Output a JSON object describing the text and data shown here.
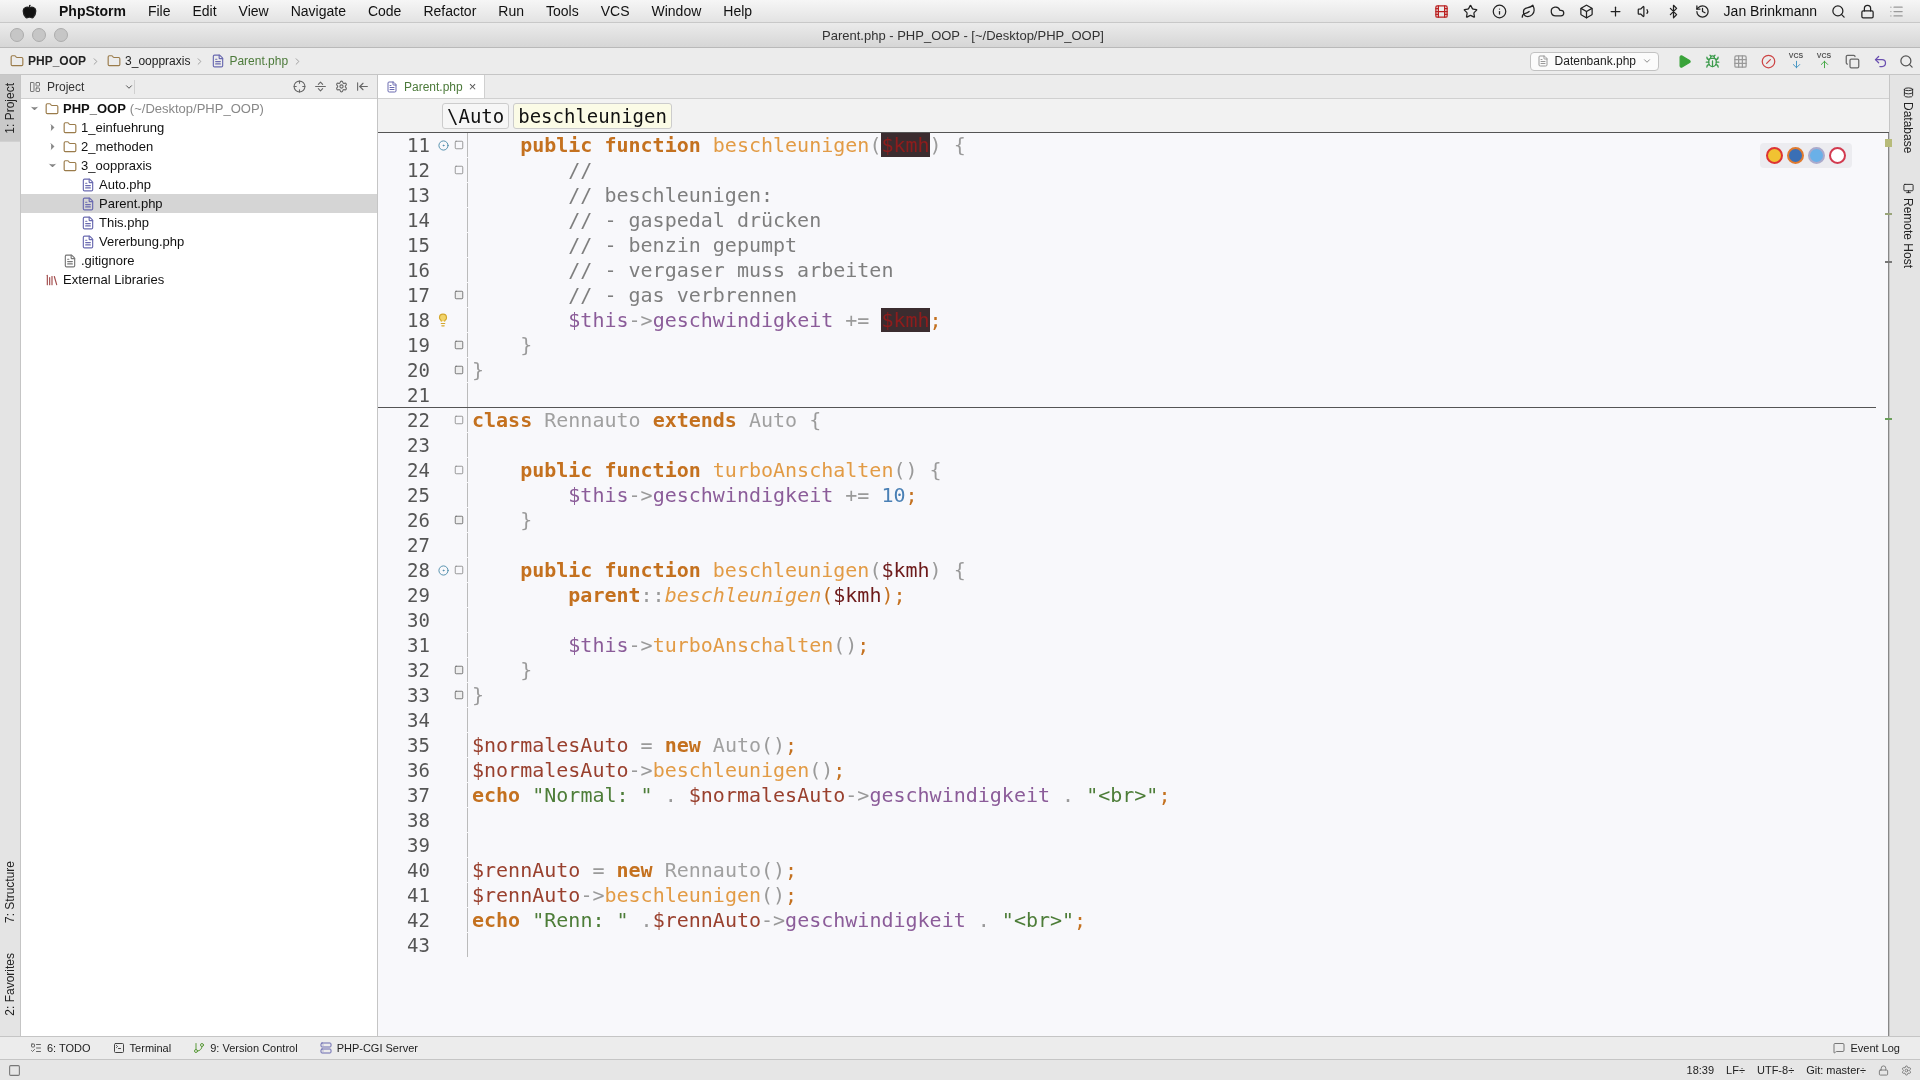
{
  "menu_bar": {
    "app": "PhpStorm",
    "items": [
      "File",
      "Edit",
      "View",
      "Navigate",
      "Code",
      "Refactor",
      "Run",
      "Tools",
      "VCS",
      "Window",
      "Help"
    ],
    "user": "Jan Brinkmann"
  },
  "window": {
    "title": "Parent.php - PHP_OOP - [~/Desktop/PHP_OOP]"
  },
  "breadcrumbs": [
    {
      "label": "PHP_OOP",
      "kind": "folder"
    },
    {
      "label": "3_ooppraxis",
      "kind": "folder"
    },
    {
      "label": "Parent.php",
      "kind": "php"
    }
  ],
  "run_config": "Datenbank.php",
  "toolbar": [
    {
      "kind": "run"
    },
    {
      "kind": "debug"
    },
    {
      "kind": "coverage"
    },
    {
      "kind": "stop"
    },
    {
      "kind": "vcs_update",
      "label": "VCS"
    },
    {
      "kind": "vcs_commit",
      "label": "VCS"
    },
    {
      "kind": "history"
    },
    {
      "kind": "revert"
    }
  ],
  "left_stripe": {
    "top": [
      {
        "label": "1: Project",
        "selected": true
      }
    ],
    "bottom": [
      {
        "label": "7: Structure",
        "selected": false
      },
      {
        "label": "2: Favorites",
        "selected": false
      }
    ]
  },
  "right_stripe": [
    {
      "label": "Database"
    },
    {
      "label": "Remote Host"
    }
  ],
  "project": {
    "title": "Project",
    "tree": [
      {
        "label": "PHP_OOP",
        "detail": "(~/Desktop/PHP_OOP)",
        "kind": "folder",
        "expanded": true,
        "selected": false,
        "children": [
          {
            "label": "1_einfuehrung",
            "kind": "folder",
            "expanded": false,
            "selected": false
          },
          {
            "label": "2_methoden",
            "kind": "folder",
            "expanded": false,
            "selected": false
          },
          {
            "label": "3_ooppraxis",
            "kind": "folder",
            "expanded": true,
            "selected": false,
            "children": [
              {
                "label": "Auto.php",
                "kind": "php",
                "selected": false
              },
              {
                "label": "Parent.php",
                "kind": "php",
                "selected": true
              },
              {
                "label": "This.php",
                "kind": "php",
                "selected": false
              },
              {
                "label": "Vererbung.php",
                "kind": "php",
                "selected": false
              }
            ]
          },
          {
            "label": ".gitignore",
            "kind": "text",
            "selected": false
          }
        ]
      },
      {
        "label": "External Libraries",
        "kind": "library",
        "selected": false
      }
    ]
  },
  "editor": {
    "tabs": [
      {
        "label": "Parent.php",
        "selected": true,
        "close": "×"
      }
    ],
    "crumbs": [
      {
        "label": "\\Auto"
      },
      {
        "label": "beschleunigen"
      }
    ],
    "lines": [
      {
        "number": "11",
        "marker": {
          "kind": "override"
        },
        "fold": {
          "kind": "start"
        },
        "separator": false,
        "tokens": [
          {
            "kind": "keyword",
            "text": "    public function "
          },
          {
            "kind": "function",
            "text": "beschleunigen"
          },
          {
            "kind": "punct",
            "text": "("
          },
          {
            "kind": "highlight",
            "text": "$kmh"
          },
          {
            "kind": "punct",
            "text": ") {"
          }
        ]
      },
      {
        "number": "12",
        "fold": {
          "kind": "start"
        },
        "separator": false,
        "tokens": [
          {
            "kind": "comment",
            "text": "        //"
          }
        ]
      },
      {
        "number": "13",
        "separator": false,
        "tokens": [
          {
            "kind": "comment",
            "text": "        // beschleunigen:"
          }
        ]
      },
      {
        "number": "14",
        "separator": false,
        "tokens": [
          {
            "kind": "comment",
            "text": "        // - gaspedal drücken"
          }
        ]
      },
      {
        "number": "15",
        "separator": false,
        "tokens": [
          {
            "kind": "comment",
            "text": "        // - benzin gepumpt"
          }
        ]
      },
      {
        "number": "16",
        "separator": false,
        "tokens": [
          {
            "kind": "comment",
            "text": "        // - vergaser muss arbeiten"
          }
        ]
      },
      {
        "number": "17",
        "fold": {
          "kind": "end"
        },
        "separator": false,
        "tokens": [
          {
            "kind": "comment",
            "text": "        // - gas verbrennen"
          }
        ]
      },
      {
        "number": "18",
        "marker": {
          "kind": "bulb"
        },
        "separator": false,
        "tokens": [
          {
            "kind": "field",
            "text": "        $this"
          },
          {
            "kind": "punct",
            "text": "->"
          },
          {
            "kind": "field",
            "text": "geschwindigkeit"
          },
          {
            "kind": "punct",
            "text": " += "
          },
          {
            "kind": "highlight",
            "text": "$kmh"
          },
          {
            "kind": "semicolon",
            "text": ";"
          }
        ]
      },
      {
        "number": "19",
        "fold": {
          "kind": "end"
        },
        "separator": false,
        "tokens": [
          {
            "kind": "punct",
            "text": "    }"
          }
        ]
      },
      {
        "number": "20",
        "fold": {
          "kind": "end"
        },
        "separator": false,
        "tokens": [
          {
            "kind": "punct",
            "text": "}"
          }
        ]
      },
      {
        "number": "21",
        "separator": true
      },
      {
        "number": "22",
        "fold": {
          "kind": "start"
        },
        "separator": false,
        "tokens": [
          {
            "kind": "keyword",
            "text": "class "
          },
          {
            "kind": "class",
            "text": "Rennauto "
          },
          {
            "kind": "keyword",
            "text": "extends "
          },
          {
            "kind": "class",
            "text": "Auto "
          },
          {
            "kind": "punct",
            "text": "{"
          }
        ]
      },
      {
        "number": "23",
        "separator": false
      },
      {
        "number": "24",
        "fold": {
          "kind": "start"
        },
        "separator": false,
        "tokens": [
          {
            "kind": "keyword",
            "text": "    public function "
          },
          {
            "kind": "function",
            "text": "turboAnschalten"
          },
          {
            "kind": "punct",
            "text": "() {"
          }
        ]
      },
      {
        "number": "25",
        "separator": false,
        "tokens": [
          {
            "kind": "field",
            "text": "        $this"
          },
          {
            "kind": "punct",
            "text": "->"
          },
          {
            "kind": "field",
            "text": "geschwindigkeit"
          },
          {
            "kind": "punct",
            "text": " += "
          },
          {
            "kind": "number",
            "text": "10"
          },
          {
            "kind": "semicolon",
            "text": ";"
          }
        ]
      },
      {
        "number": "26",
        "fold": {
          "kind": "end"
        },
        "separator": false,
        "tokens": [
          {
            "kind": "punct",
            "text": "    }"
          }
        ]
      },
      {
        "number": "27",
        "separator": false
      },
      {
        "number": "28",
        "marker": {
          "kind": "override"
        },
        "fold": {
          "kind": "start"
        },
        "separator": false,
        "tokens": [
          {
            "kind": "keyword",
            "text": "    public function "
          },
          {
            "kind": "function",
            "text": "beschleunigen"
          },
          {
            "kind": "punct",
            "text": "("
          },
          {
            "kind": "param",
            "text": "$kmh"
          },
          {
            "kind": "punct",
            "text": ") {"
          }
        ]
      },
      {
        "number": "29",
        "separator": false,
        "tokens": [
          {
            "kind": "keyword",
            "text": "        parent"
          },
          {
            "kind": "punct",
            "text": "::"
          },
          {
            "kind": "static_call",
            "text": "beschleunigen"
          },
          {
            "kind": "semicolon",
            "text": "("
          },
          {
            "kind": "param",
            "text": "$kmh"
          },
          {
            "kind": "semicolon",
            "text": ");"
          }
        ]
      },
      {
        "number": "30",
        "separator": false
      },
      {
        "number": "31",
        "separator": false,
        "tokens": [
          {
            "kind": "field",
            "text": "        $this"
          },
          {
            "kind": "punct",
            "text": "->"
          },
          {
            "kind": "function",
            "text": "turboAnschalten"
          },
          {
            "kind": "punct",
            "text": "()"
          },
          {
            "kind": "semicolon",
            "text": ";"
          }
        ]
      },
      {
        "number": "32",
        "fold": {
          "kind": "end"
        },
        "separator": false,
        "tokens": [
          {
            "kind": "punct",
            "text": "    }"
          }
        ]
      },
      {
        "number": "33",
        "fold": {
          "kind": "end"
        },
        "separator": false,
        "tokens": [
          {
            "kind": "punct",
            "text": "}"
          }
        ]
      },
      {
        "number": "34",
        "separator": false
      },
      {
        "number": "35",
        "separator": false,
        "tokens": [
          {
            "kind": "variable",
            "text": "$normalesAuto"
          },
          {
            "kind": "punct",
            "text": " = "
          },
          {
            "kind": "keyword",
            "text": "new "
          },
          {
            "kind": "class",
            "text": "Auto"
          },
          {
            "kind": "punct",
            "text": "()"
          },
          {
            "kind": "semicolon",
            "text": ";"
          }
        ]
      },
      {
        "number": "36",
        "separator": false,
        "tokens": [
          {
            "kind": "variable",
            "text": "$normalesAuto"
          },
          {
            "kind": "punct",
            "text": "->"
          },
          {
            "kind": "function",
            "text": "beschleunigen"
          },
          {
            "kind": "punct",
            "text": "()"
          },
          {
            "kind": "semicolon",
            "text": ";"
          }
        ]
      },
      {
        "number": "37",
        "separator": false,
        "tokens": [
          {
            "kind": "keyword",
            "text": "echo "
          },
          {
            "kind": "string",
            "text": "\"Normal: \""
          },
          {
            "kind": "punct",
            "text": " . "
          },
          {
            "kind": "variable",
            "text": "$normalesAuto"
          },
          {
            "kind": "punct",
            "text": "->"
          },
          {
            "kind": "field",
            "text": "geschwindigkeit"
          },
          {
            "kind": "punct",
            "text": " . "
          },
          {
            "kind": "string",
            "text": "\"<br>\""
          },
          {
            "kind": "semicolon",
            "text": ";"
          }
        ]
      },
      {
        "number": "38",
        "separator": false
      },
      {
        "number": "39",
        "separator": false
      },
      {
        "number": "40",
        "separator": false,
        "tokens": [
          {
            "kind": "variable",
            "text": "$rennAuto"
          },
          {
            "kind": "punct",
            "text": " = "
          },
          {
            "kind": "keyword",
            "text": "new "
          },
          {
            "kind": "class",
            "text": "Rennauto"
          },
          {
            "kind": "punct",
            "text": "()"
          },
          {
            "kind": "semicolon",
            "text": ";"
          }
        ]
      },
      {
        "number": "41",
        "separator": false,
        "tokens": [
          {
            "kind": "variable",
            "text": "$rennAuto"
          },
          {
            "kind": "punct",
            "text": "->"
          },
          {
            "kind": "function",
            "text": "beschleunigen"
          },
          {
            "kind": "punct",
            "text": "()"
          },
          {
            "kind": "semicolon",
            "text": ";"
          }
        ]
      },
      {
        "number": "42",
        "separator": false,
        "tokens": [
          {
            "kind": "keyword",
            "text": "echo "
          },
          {
            "kind": "string",
            "text": "\"Renn: \""
          },
          {
            "kind": "punct",
            "text": " ."
          },
          {
            "kind": "variable",
            "text": "$rennAuto"
          },
          {
            "kind": "punct",
            "text": "->"
          },
          {
            "kind": "field",
            "text": "geschwindigkeit"
          },
          {
            "kind": "punct",
            "text": " . "
          },
          {
            "kind": "string",
            "text": "\"<br>\""
          },
          {
            "kind": "semicolon",
            "text": ";"
          }
        ]
      },
      {
        "number": "43",
        "separator": false
      }
    ]
  },
  "tool_bar": {
    "left": [
      {
        "label": "6: TODO",
        "kind": "todo"
      },
      {
        "label": "Terminal",
        "kind": "terminal"
      },
      {
        "label": "9: Version Control",
        "kind": "vcs"
      },
      {
        "label": "PHP-CGI Server",
        "kind": "server"
      }
    ],
    "right": "Event Log"
  },
  "status_bar": {
    "items": [
      "18:39",
      "LF÷",
      "UTF-8÷",
      "Git: master÷"
    ]
  }
}
